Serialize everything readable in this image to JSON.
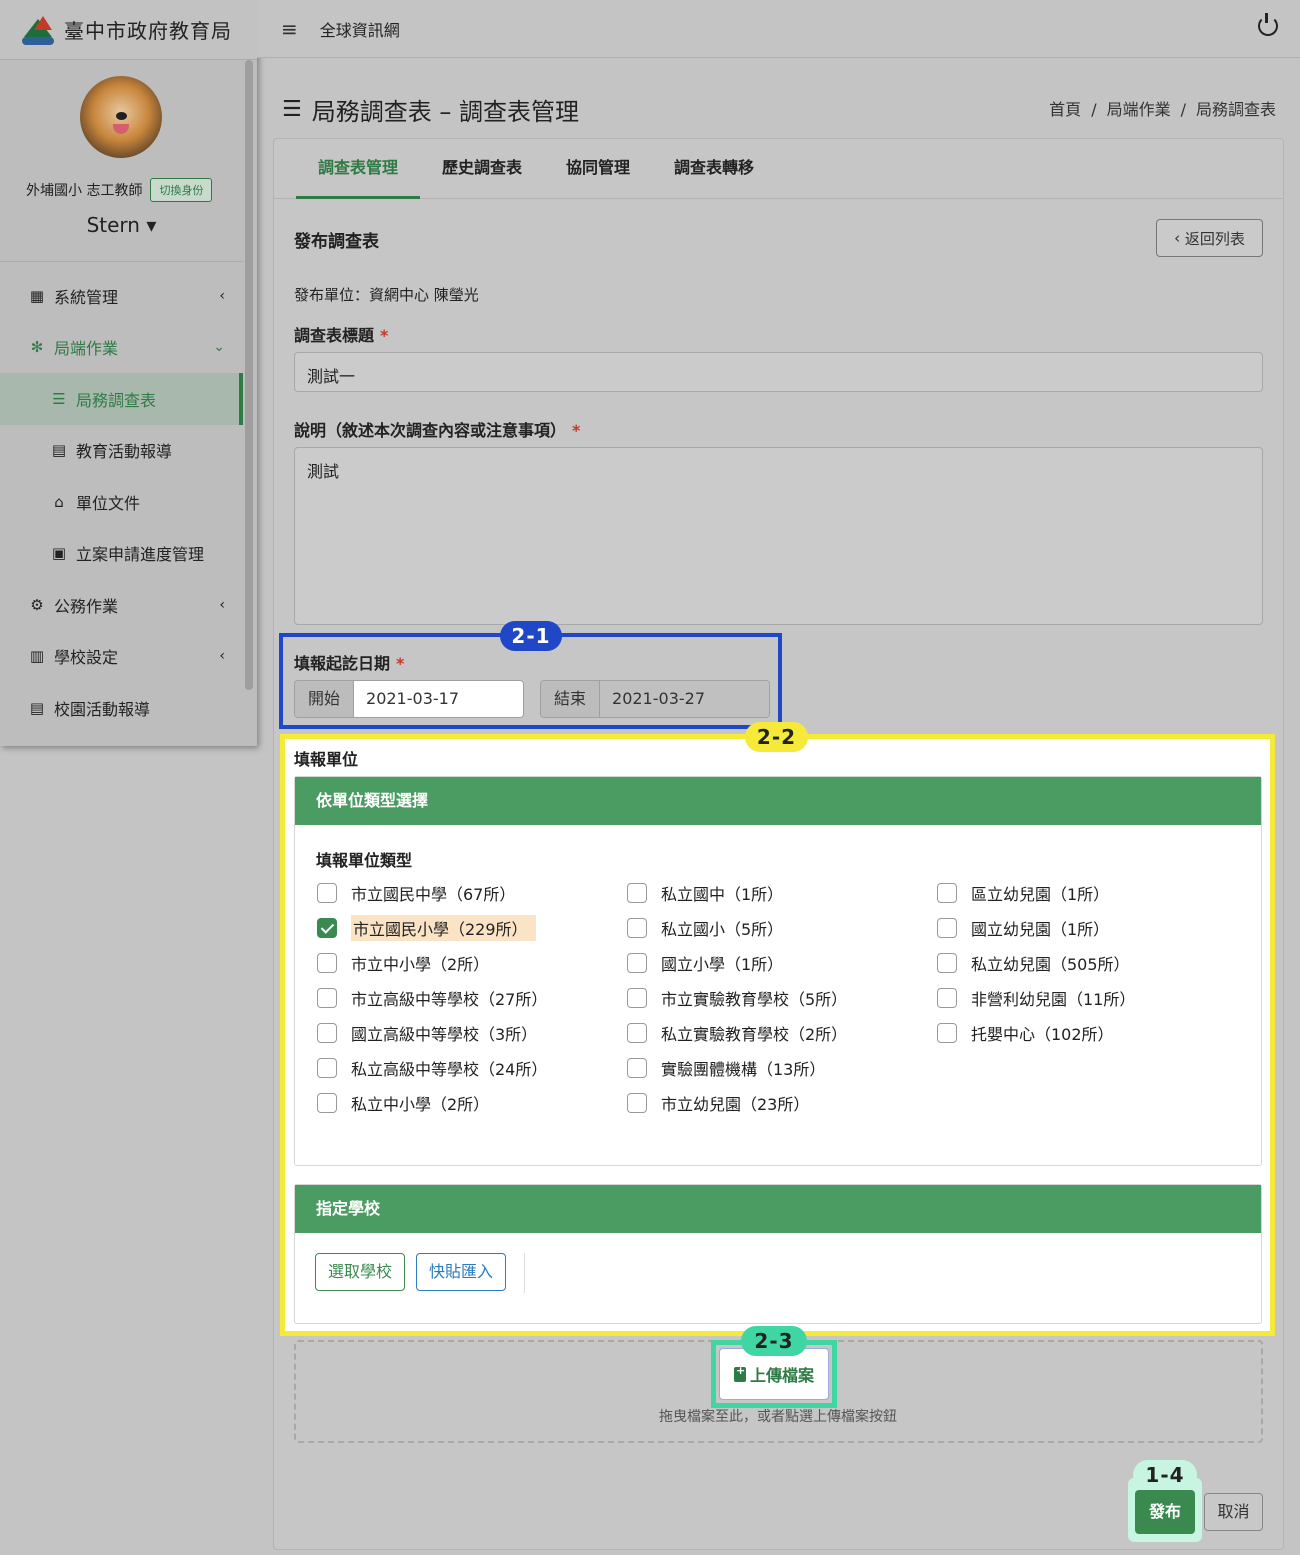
{
  "sidebar": {
    "org_name": "臺中市政府教育局",
    "user_role": "外埔國小 志工教師",
    "switch_label": "切換身份",
    "user_name": "Stern",
    "items": [
      {
        "label": "系統管理",
        "icon": "grid-icon"
      },
      {
        "label": "局端作業",
        "icon": "gear-flower-icon"
      },
      {
        "label": "局務調查表",
        "icon": "checklist-icon"
      },
      {
        "label": "教育活動報導",
        "icon": "newspaper-icon"
      },
      {
        "label": "單位文件",
        "icon": "folder-icon"
      },
      {
        "label": "立案申請進度管理",
        "icon": "calendar-check-icon"
      },
      {
        "label": "公務作業",
        "icon": "cogs-icon"
      },
      {
        "label": "學校設定",
        "icon": "building-icon"
      },
      {
        "label": "校園活動報導",
        "icon": "newspaper-icon"
      }
    ]
  },
  "topbar": {
    "title": "全球資訊網"
  },
  "page": {
    "title": "局務調查表 – 調查表管理",
    "breadcrumb": [
      "首頁",
      "局端作業",
      "局務調查表"
    ]
  },
  "tabs": [
    "調查表管理",
    "歷史調查表",
    "協同管理",
    "調查表轉移"
  ],
  "form": {
    "section_title": "發布調查表",
    "back_label": "返回列表",
    "publisher": "發布單位：資網中心 陳瑩光",
    "title_label": "調查表標題",
    "title_value": "測試一",
    "desc_label": "說明（敘述本次調查內容或注意事項）",
    "desc_value": "測試",
    "date_label": "填報起訖日期",
    "start_label": "開始",
    "start_value": "2021-03-17",
    "end_label": "結束",
    "end_value": "2021-03-27",
    "unit_label": "填報單位",
    "by_type_header": "依單位類型選擇",
    "type_label": "填報單位類型",
    "types": [
      {
        "label": "市立國民中學（67所）",
        "checked": false
      },
      {
        "label": "市立國民小學（229所）",
        "checked": true
      },
      {
        "label": "市立中小學（2所）",
        "checked": false
      },
      {
        "label": "市立高級中等學校（27所）",
        "checked": false
      },
      {
        "label": "國立高級中等學校（3所）",
        "checked": false
      },
      {
        "label": "私立高級中等學校（24所）",
        "checked": false
      },
      {
        "label": "私立中小學（2所）",
        "checked": false
      },
      {
        "label": "私立國中（1所）",
        "checked": false
      },
      {
        "label": "私立國小（5所）",
        "checked": false
      },
      {
        "label": "國立小學（1所）",
        "checked": false
      },
      {
        "label": "市立實驗教育學校（5所）",
        "checked": false
      },
      {
        "label": "私立實驗教育學校（2所）",
        "checked": false
      },
      {
        "label": "實驗團體機構（13所）",
        "checked": false
      },
      {
        "label": "市立幼兒園（23所）",
        "checked": false
      },
      {
        "label": "區立幼兒園（1所）",
        "checked": false
      },
      {
        "label": "國立幼兒園（1所）",
        "checked": false
      },
      {
        "label": "私立幼兒園（505所）",
        "checked": false
      },
      {
        "label": "非營利幼兒園（11所）",
        "checked": false
      },
      {
        "label": "托嬰中心（102所）",
        "checked": false
      }
    ],
    "assign_header": "指定學校",
    "select_school_label": "選取學校",
    "paste_import_label": "快貼匯入",
    "upload_label": "上傳檔案",
    "drop_hint": "拖曳檔案至此，或者點選上傳檔案按鈕",
    "publish_label": "發布",
    "cancel_label": "取消"
  },
  "annotations": [
    "2-1",
    "2-2",
    "2-3",
    "1-4"
  ],
  "colors": {
    "brand_green": "#3a8a4f",
    "header_green": "#4b9c63",
    "annot_blue": "#1f47c7",
    "annot_yellow": "#f5ea3a",
    "annot_teal": "#3fd6a4"
  }
}
